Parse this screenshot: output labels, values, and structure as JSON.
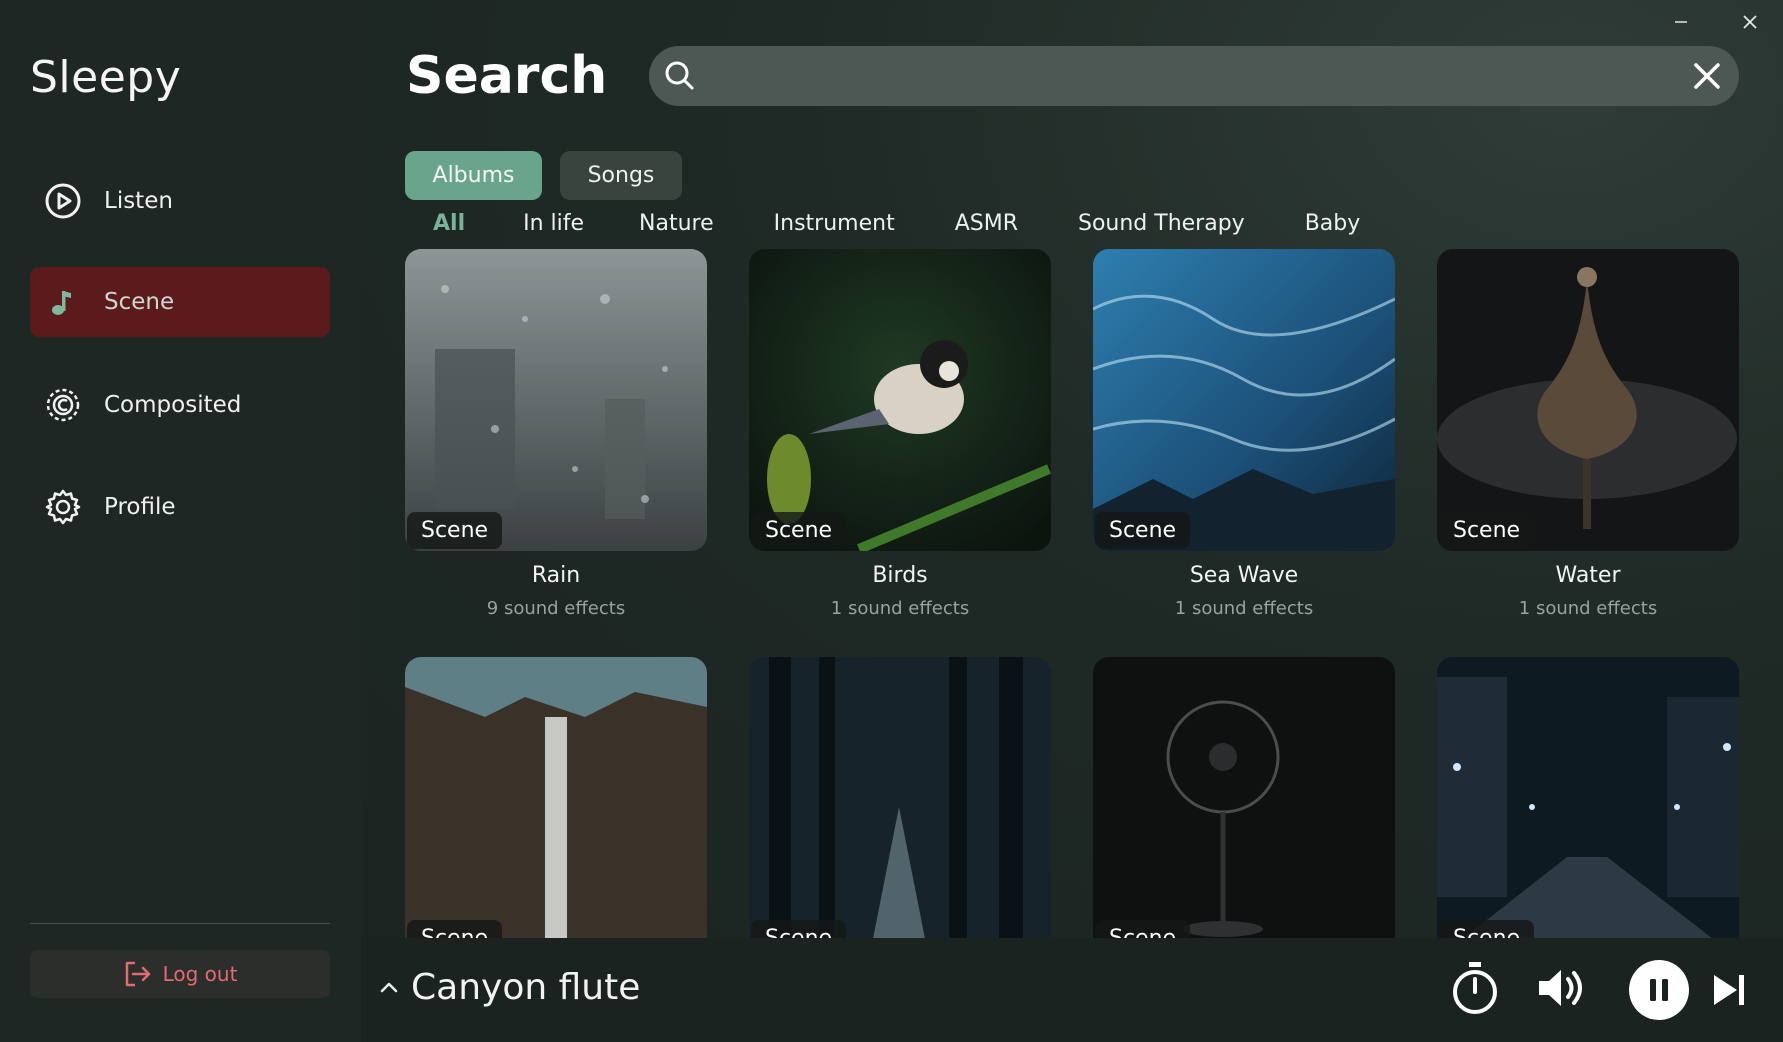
{
  "app": {
    "name": "Sleepy"
  },
  "sidebar": {
    "items": [
      {
        "label": "Listen",
        "icon": "play-circle-icon"
      },
      {
        "label": "Scene",
        "icon": "music-note-icon",
        "active": true
      },
      {
        "label": "Composited",
        "icon": "composite-icon"
      },
      {
        "label": "Profile",
        "icon": "gear-icon"
      }
    ],
    "logout_label": "Log out"
  },
  "main": {
    "title": "Search",
    "search": {
      "value": "",
      "placeholder": ""
    },
    "segments": [
      {
        "label": "Albums",
        "active": true
      },
      {
        "label": "Songs",
        "active": false
      }
    ],
    "categories": [
      {
        "label": "All",
        "active": true
      },
      {
        "label": "In life"
      },
      {
        "label": "Nature"
      },
      {
        "label": "Instrument"
      },
      {
        "label": "ASMR"
      },
      {
        "label": "Sound Therapy"
      },
      {
        "label": "Baby"
      }
    ],
    "cards": [
      {
        "badge": "Scene",
        "title": "Rain",
        "subtitle": "9 sound effects"
      },
      {
        "badge": "Scene",
        "title": "Birds",
        "subtitle": "1 sound effects"
      },
      {
        "badge": "Scene",
        "title": "Sea Wave",
        "subtitle": "1 sound effects"
      },
      {
        "badge": "Scene",
        "title": "Water",
        "subtitle": "1 sound effects"
      },
      {
        "badge": "Scene",
        "title": "",
        "subtitle": ""
      },
      {
        "badge": "Scene",
        "title": "",
        "subtitle": ""
      },
      {
        "badge": "Scene",
        "title": "",
        "subtitle": ""
      },
      {
        "badge": "Scene",
        "title": "",
        "subtitle": ""
      }
    ]
  },
  "player": {
    "now_playing": "Canyon flute"
  },
  "colors": {
    "accent": "#69a58b",
    "active_nav": "#5b1b1d",
    "logout": "#e06b73"
  }
}
